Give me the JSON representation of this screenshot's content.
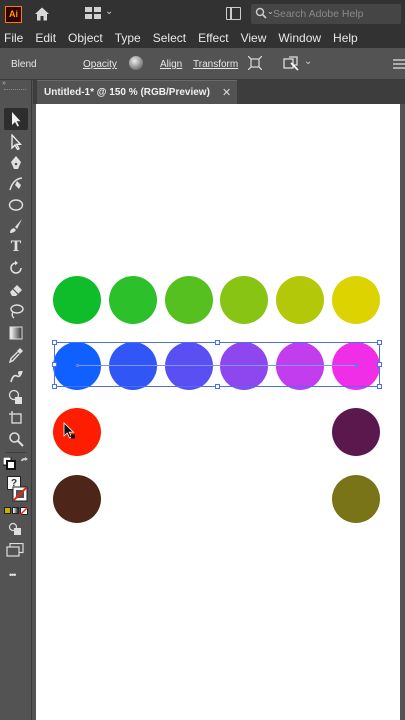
{
  "titlebar": {
    "logo_text": "Ai",
    "search_placeholder": "Search Adobe Help"
  },
  "menus": [
    "File",
    "Edit",
    "Object",
    "Type",
    "Select",
    "Effect",
    "View",
    "Window",
    "Help"
  ],
  "controlbar": {
    "blend_label": "Blend",
    "opacity_label": "Opacity",
    "align_label": "Align",
    "transform_label": "Transform"
  },
  "document": {
    "tab_title": "Untitled-1* @ 150 % (RGB/Preview)",
    "close_glyph": "✕"
  },
  "toolbar": {
    "type_tool_glyph": "T",
    "question_glyph": "?",
    "more_glyph": "•••"
  },
  "artwork": {
    "row1_colors": [
      "#0fbd2a",
      "#2cc02a",
      "#56c020",
      "#88c413",
      "#b3c809",
      "#dcd301"
    ],
    "row2_colors": [
      "#1060ff",
      "#3056f5",
      "#5a4ff2",
      "#8e46ef",
      "#c13ded",
      "#f02ee8"
    ],
    "row3": {
      "left": "#ff1d00",
      "right": "#5a184d"
    },
    "row4": {
      "left": "#4d2519",
      "right": "#787417"
    }
  },
  "colors": {
    "selection": "#4a6ef5",
    "ui_dark": "#323232",
    "ui_mid": "#535353"
  }
}
